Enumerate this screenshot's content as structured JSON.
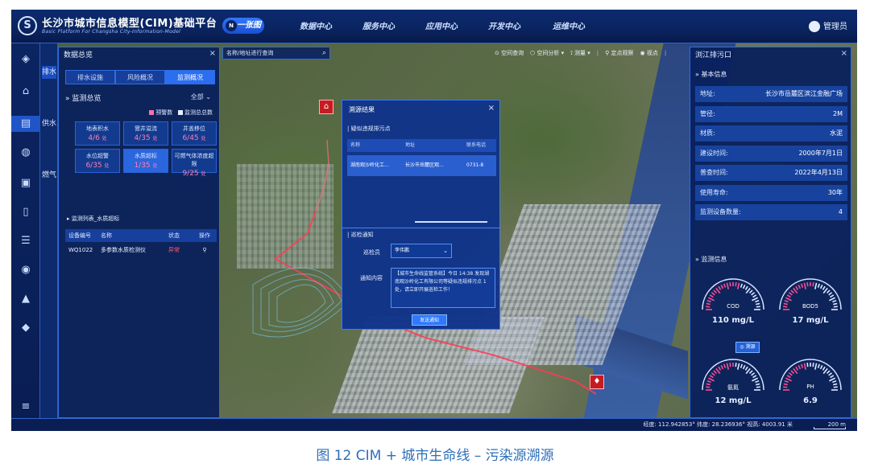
{
  "header": {
    "title": "长沙市城市信息模型(CIM)基础平台",
    "subtitle": "Basic Platform For Changsha City-Information-Model",
    "logo_glyph": "S",
    "tabs": [
      {
        "label": "一张图",
        "icon": "N"
      },
      {
        "label": "数据中心"
      },
      {
        "label": "服务中心"
      },
      {
        "label": "应用中心"
      },
      {
        "label": "开发中心"
      },
      {
        "label": "运维中心"
      }
    ],
    "user": "管理员"
  },
  "rail": {
    "icons": [
      "layers-icon",
      "crane-icon",
      "city-lifeline-icon",
      "globe-icon",
      "building-icon",
      "document-icon",
      "stack-icon",
      "shield-icon",
      "chart-icon",
      "diamond-icon",
      "menu-icon"
    ],
    "glyphs": [
      "◈",
      "⌂",
      "▤",
      "◍",
      "▣",
      "▯",
      "☰",
      "◉",
      "▲",
      "◆",
      "≡"
    ]
  },
  "categories": [
    "排水",
    "供水",
    "燃气"
  ],
  "left_panel": {
    "title": "数据总览",
    "close": "×",
    "tabs": [
      "排水设施",
      "风险概况",
      "监测概况"
    ],
    "active_tab": 2,
    "section1": "监测总览",
    "filter": "全部",
    "legend": [
      {
        "label": "预警数",
        "color": "#ff6fa8"
      },
      {
        "label": "监测总总数",
        "color": "#e8eefc"
      }
    ],
    "stats": [
      {
        "label": "地表积水",
        "value": "4/6",
        "unit": "处"
      },
      {
        "label": "窨井溢流",
        "value": "4/35",
        "unit": "处"
      },
      {
        "label": "井盖移位",
        "value": "6/45",
        "unit": "处"
      },
      {
        "label": "水位超警",
        "value": "6/35",
        "unit": "处"
      },
      {
        "label": "水质超标",
        "value": "1/35",
        "unit": "处"
      },
      {
        "label": "可燃气体浓度超限",
        "value": "9/25",
        "unit": "处"
      }
    ],
    "highlight_stat": 4,
    "section2": "监测列表_水质超标",
    "table_headers": [
      "设备编号",
      "名称",
      "状态",
      "操作"
    ],
    "table_rows": [
      {
        "id": "WQ1022",
        "name": "多参数水质检测仪",
        "status": "异常",
        "op": "⚲"
      }
    ]
  },
  "search": {
    "placeholder": "名称/地址进行查询",
    "icon": "⌕"
  },
  "map_tools": [
    "空间查询",
    "空间分析 ▾",
    "测量 ▾",
    "|",
    "定点观察",
    "视点",
    "|"
  ],
  "right_panel": {
    "title": "浏江排污口",
    "close": "×",
    "section1": "基本信息",
    "info": [
      {
        "k": "地址:",
        "v": "长沙市岳麓区滨江金融广场"
      },
      {
        "k": "管径:",
        "v": "2M"
      },
      {
        "k": "材质:",
        "v": "水泥"
      },
      {
        "k": "建设时间:",
        "v": "2000年7月1日"
      },
      {
        "k": "普查时间:",
        "v": "2022年4月13日"
      },
      {
        "k": "使用寿命:",
        "v": "30年"
      },
      {
        "k": "监测设备数量:",
        "v": "4"
      }
    ],
    "section2": "监测信息",
    "gauges": [
      {
        "name": "COD",
        "value": "110 mg/L",
        "level": 0.6
      },
      {
        "name": "BOD5",
        "value": "17 mg/L",
        "level": 0.55
      },
      {
        "name": "氨氮",
        "value": "12 mg/L",
        "level": 0.5
      },
      {
        "name": "PH",
        "value": "6.9",
        "level": 0.45
      }
    ],
    "trace_button": "溯源"
  },
  "dialog": {
    "title": "溯源结果",
    "close": "×",
    "section1": "疑似违规排污点",
    "headers": [
      "名称",
      "地址",
      "联系电话"
    ],
    "row": [
      "湖南观沙岭化工...",
      "长沙市岳麓区观...",
      "0731-8"
    ],
    "section2": "巡检通知",
    "inspector_label": "巡检员",
    "inspector_value": "李伟鹏",
    "content_label": "通知内容",
    "content": "【城市生命线监管系统】今日 14:38 发现湖南观沙岭化工有限公司等疑似违规排污点 1 处，请立即开展巡检工作！",
    "send": "发送通知"
  },
  "markers": [
    {
      "glyph": "⌂"
    },
    {
      "glyph": "♦"
    }
  ],
  "status_bar": {
    "coords": "经度: 112.942853° 纬度: 28.236936° 视高: 4003.91 米",
    "scale": "200 m"
  },
  "caption": "图 12   CIM + 城市生命线 – 污染源溯源",
  "colors": {
    "accent": "#2f78ff",
    "alert": "#ff5a6e",
    "panel": "#08205c"
  }
}
